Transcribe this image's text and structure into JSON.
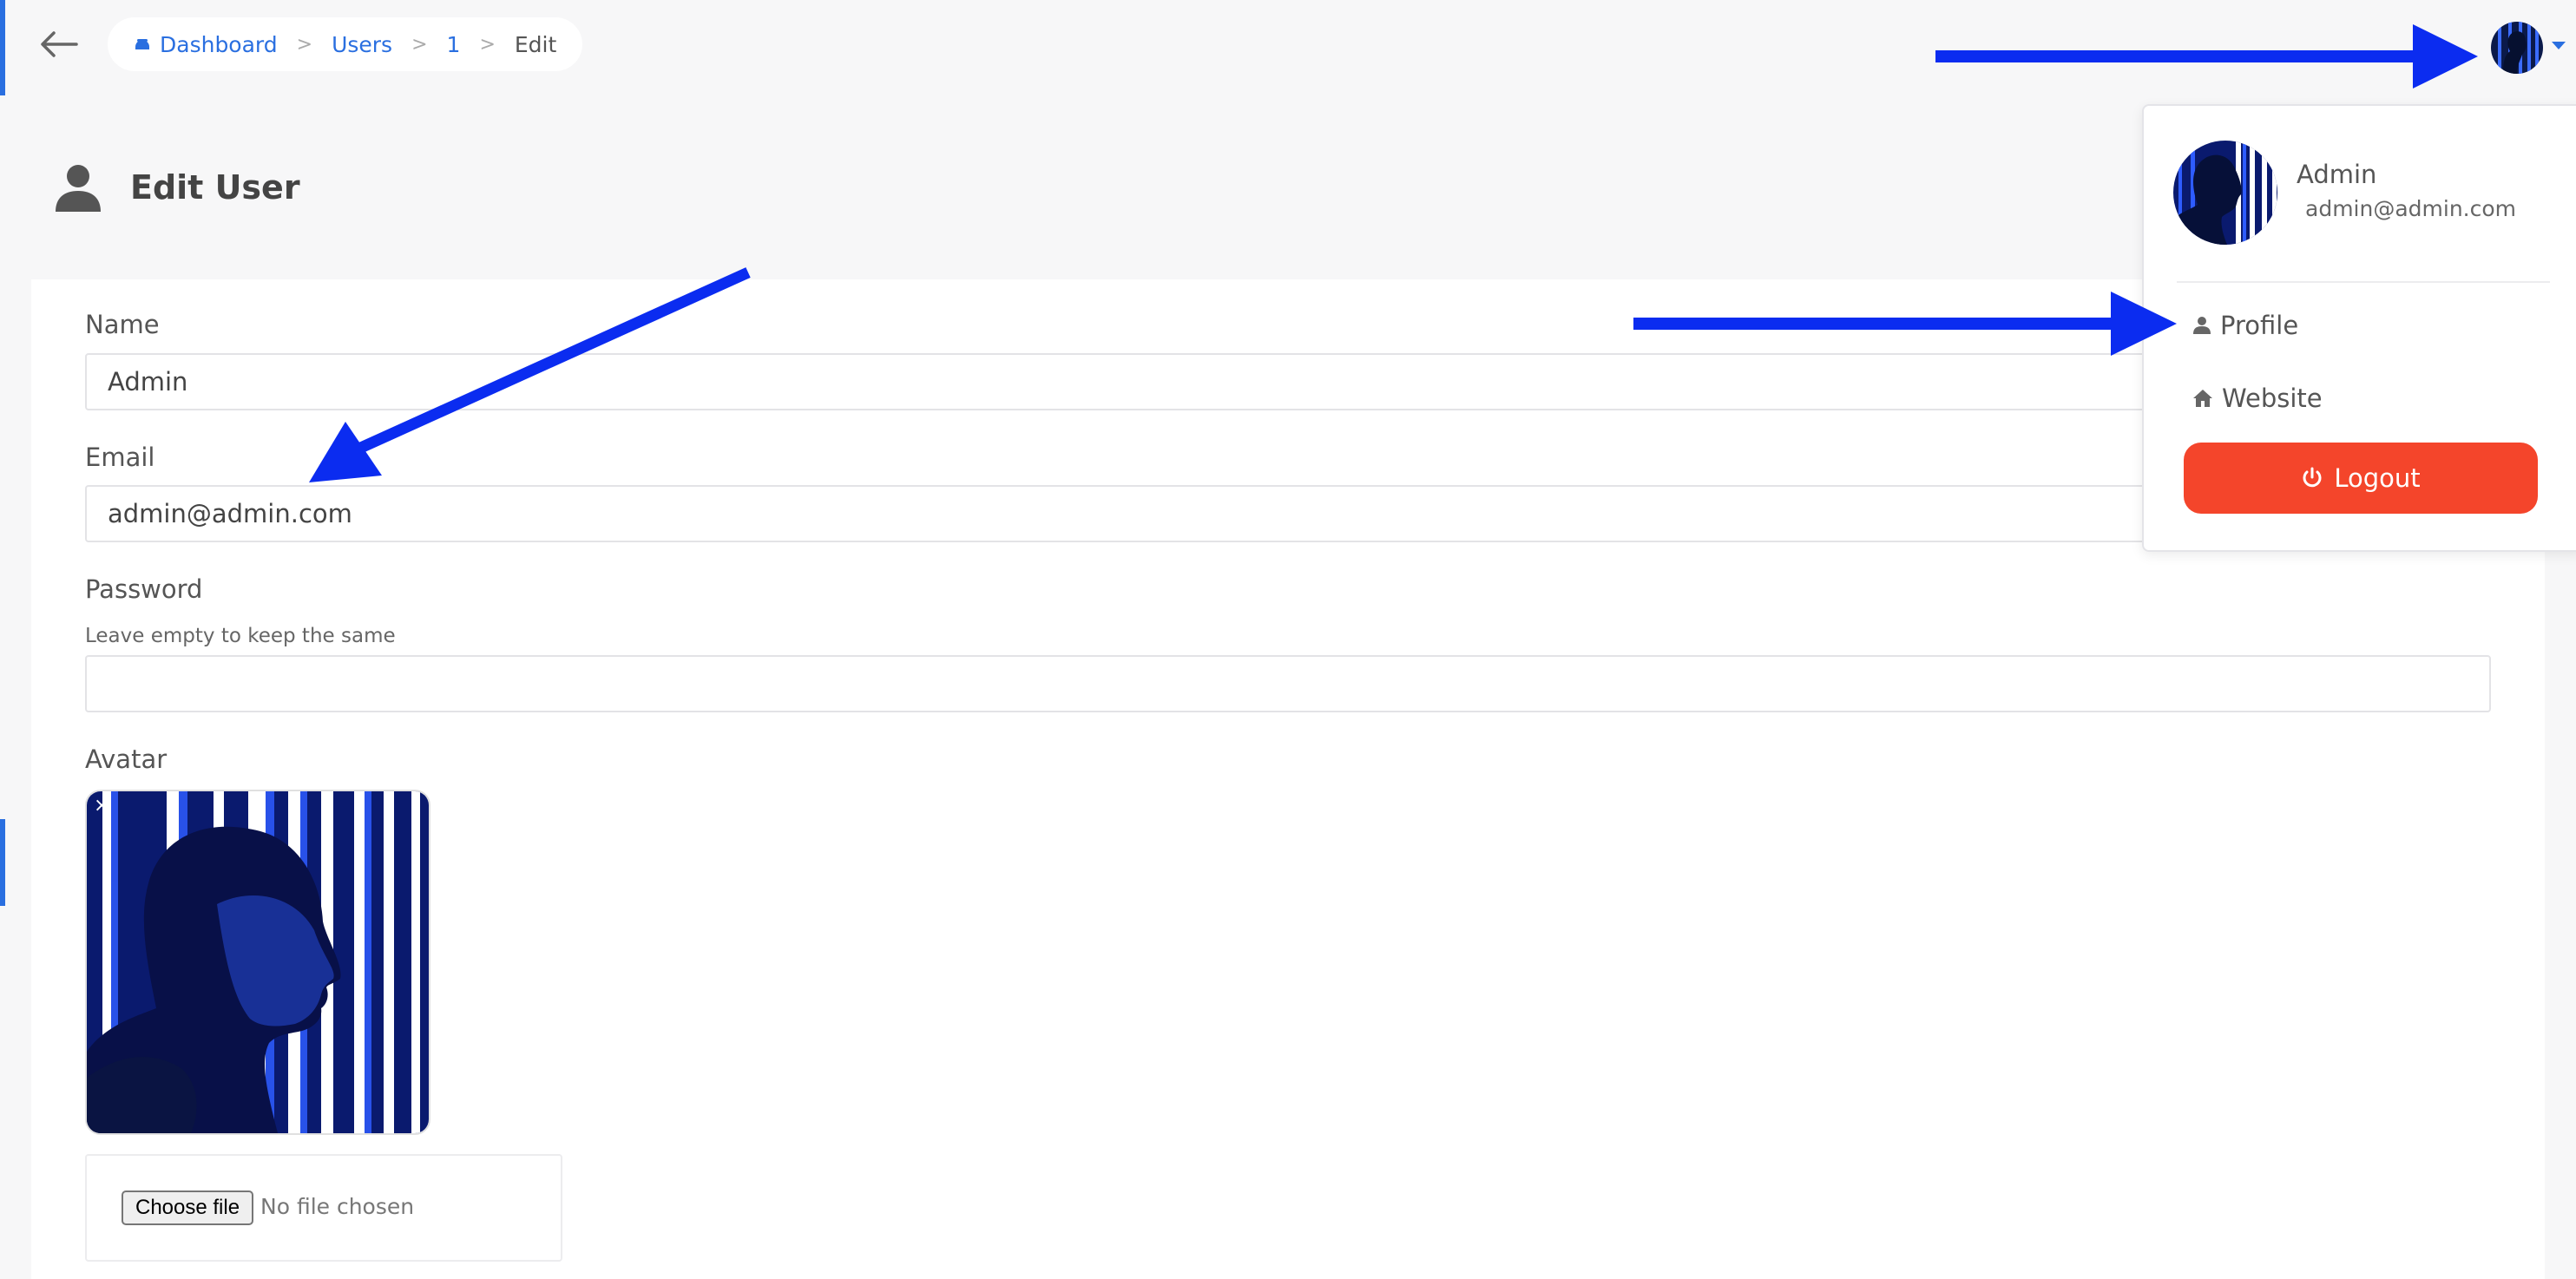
{
  "breadcrumb": {
    "items": [
      "Dashboard",
      "Users",
      "1"
    ],
    "current": "Edit"
  },
  "page": {
    "title": "Edit User"
  },
  "form": {
    "name": {
      "label": "Name",
      "value": "Admin"
    },
    "email": {
      "label": "Email",
      "value": "admin@admin.com"
    },
    "password": {
      "label": "Password",
      "hint": "Leave empty to keep the same",
      "value": ""
    },
    "avatar": {
      "label": "Avatar",
      "remove": "×",
      "choose_button": "Choose file",
      "file_status": "No file chosen"
    }
  },
  "user_menu": {
    "name": "Admin",
    "email": "admin@admin.com",
    "items": [
      "Profile",
      "Website"
    ],
    "logout": "Logout"
  },
  "colors": {
    "accent": "#2a6fe0",
    "logout": "#f4452b",
    "annotation_arrow": "#0b2cf0"
  }
}
